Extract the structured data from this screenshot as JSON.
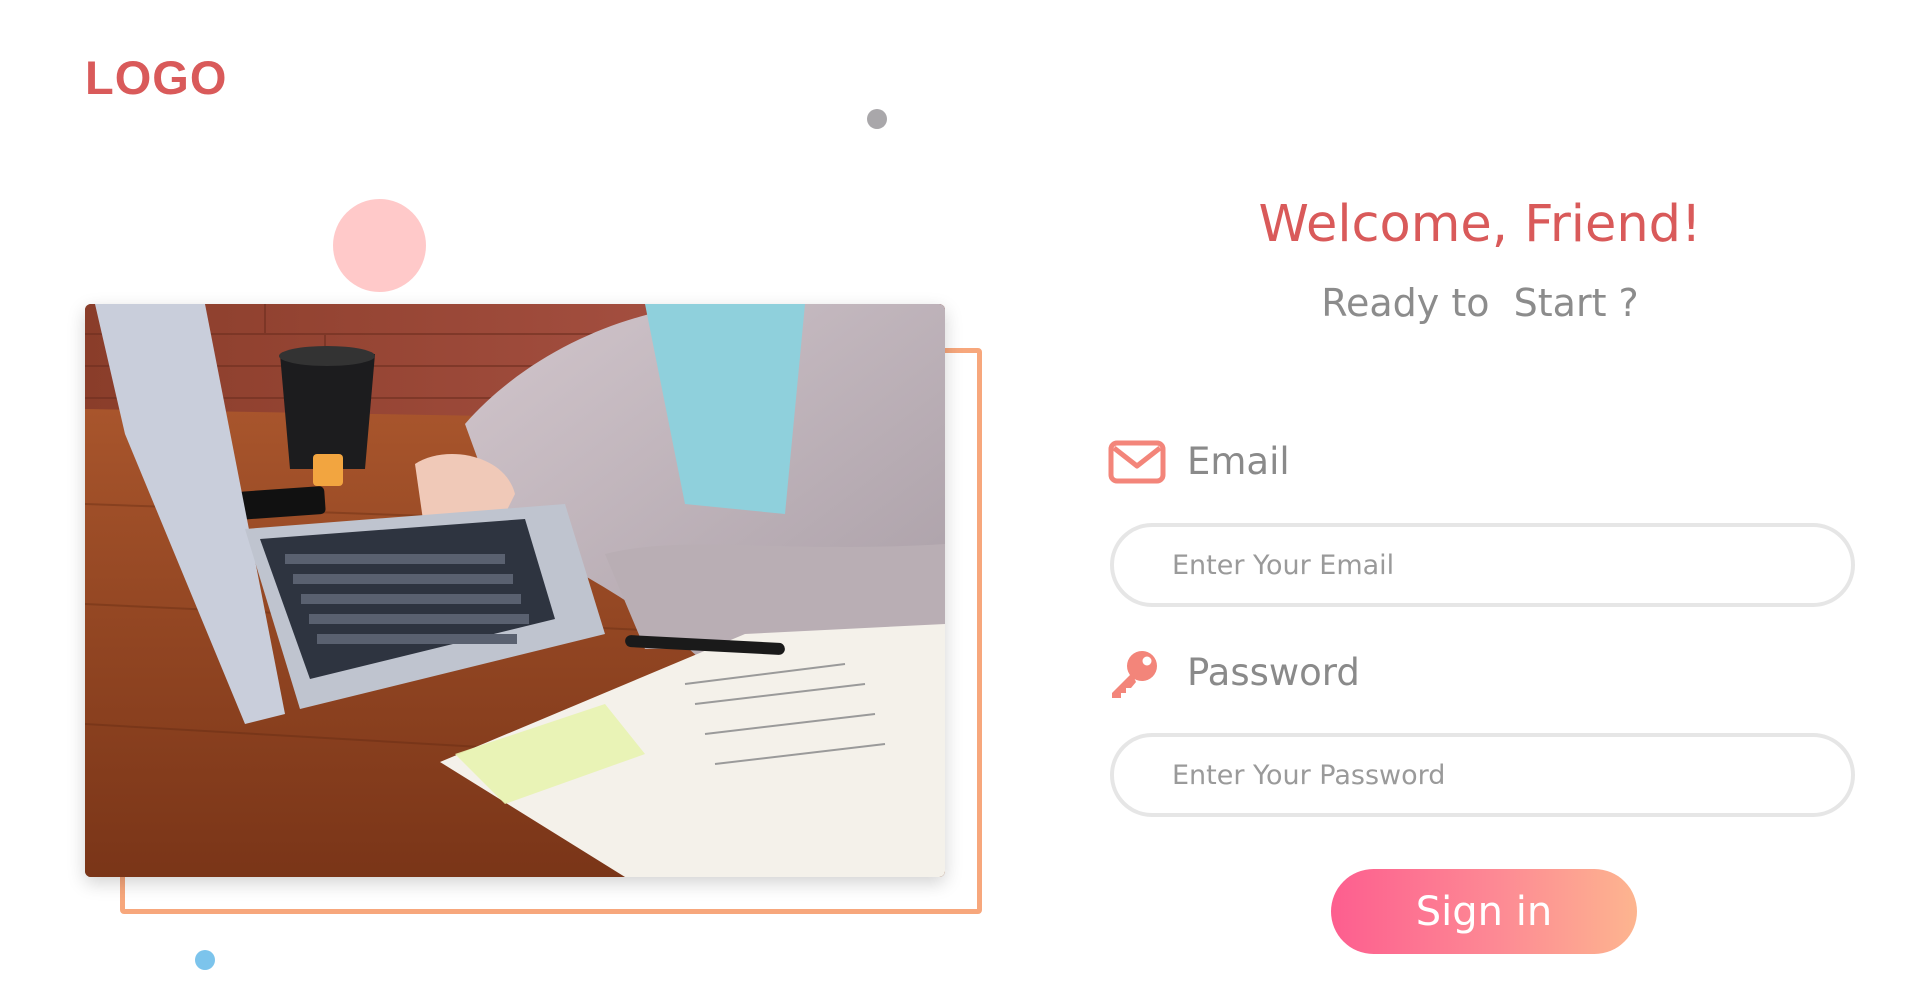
{
  "header": {
    "logo_text": "LOGO"
  },
  "hero": {
    "photo_description_icon": "laptop-desk-photo"
  },
  "form": {
    "title": "Welcome, Friend!",
    "subtitle": "Ready to  Start ?",
    "email": {
      "label": "Email",
      "icon": "envelope-icon",
      "placeholder": "Enter Your Email",
      "value": ""
    },
    "password": {
      "label": "Password",
      "icon": "key-icon",
      "placeholder": "Enter Your Password",
      "value": ""
    },
    "submit_label": "Sign in"
  },
  "colors": {
    "brand": "#d95a5a",
    "accent_orange": "#f7a77c",
    "button_gradient_start": "#fd5e8f",
    "button_gradient_end": "#fdb58f",
    "decor_pink": "#ffc9c9",
    "decor_gray": "#a9a7aa",
    "decor_blue": "#7cc4ec"
  }
}
